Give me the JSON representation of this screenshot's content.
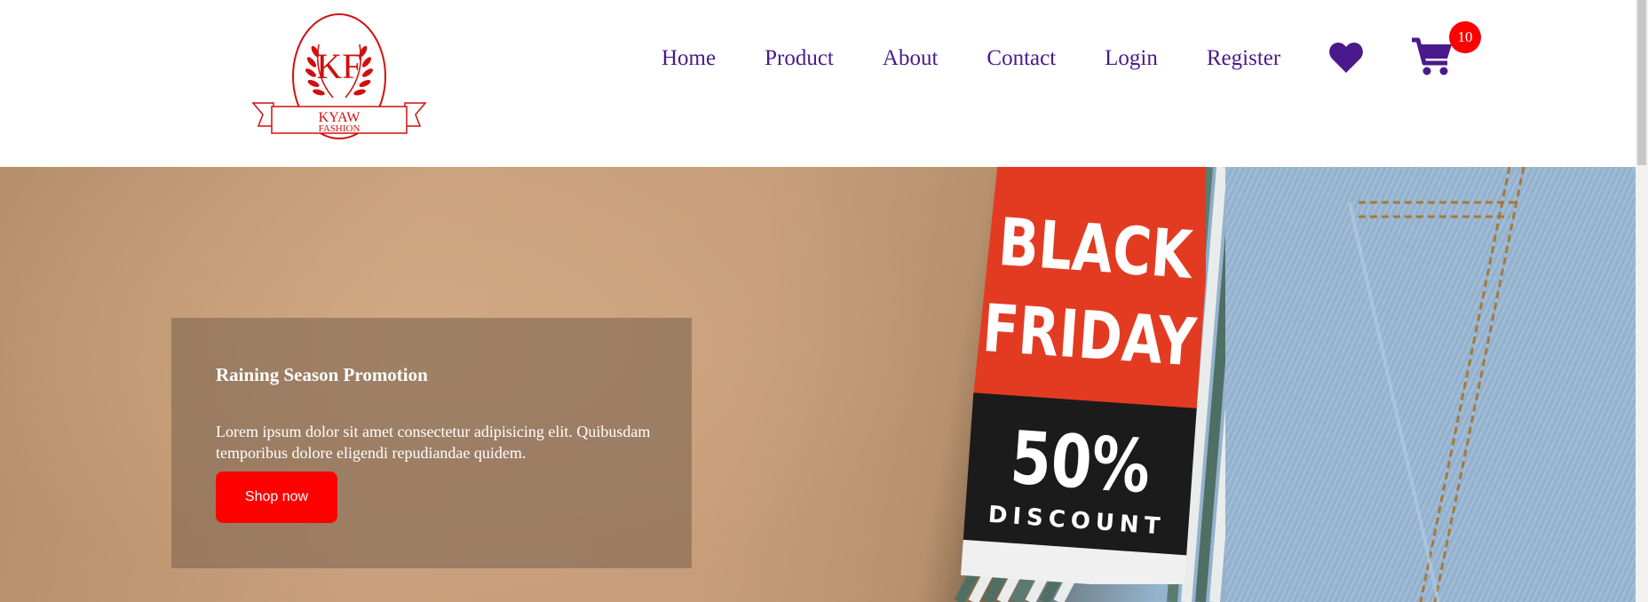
{
  "brand": {
    "monogram": "KF",
    "name_line1": "KYAW",
    "name_line2": "FASHION",
    "color": "#d10f0f"
  },
  "nav": {
    "items": [
      {
        "label": "Home"
      },
      {
        "label": "Product"
      },
      {
        "label": "About"
      },
      {
        "label": "Contact"
      },
      {
        "label": "Login"
      },
      {
        "label": "Register"
      }
    ],
    "color": "#4a1a8c"
  },
  "header_icons": {
    "wishlist_icon": "heart-icon",
    "cart_icon": "shopping-cart-icon",
    "cart_count": "10",
    "badge_color": "#ff0000"
  },
  "hero": {
    "title": "Raining Season Promotion",
    "text": "Lorem ipsum dolor sit amet consectetur adipisicing elit. Quibusdam temporibus dolore eligendi repudiandae quidem.",
    "button_label": "Shop now",
    "button_color": "#ff0000",
    "tag_line1": "BLACK",
    "tag_line2": "FRIDAY",
    "tag_percent": "50%",
    "tag_discount": "DISCOUNT"
  }
}
